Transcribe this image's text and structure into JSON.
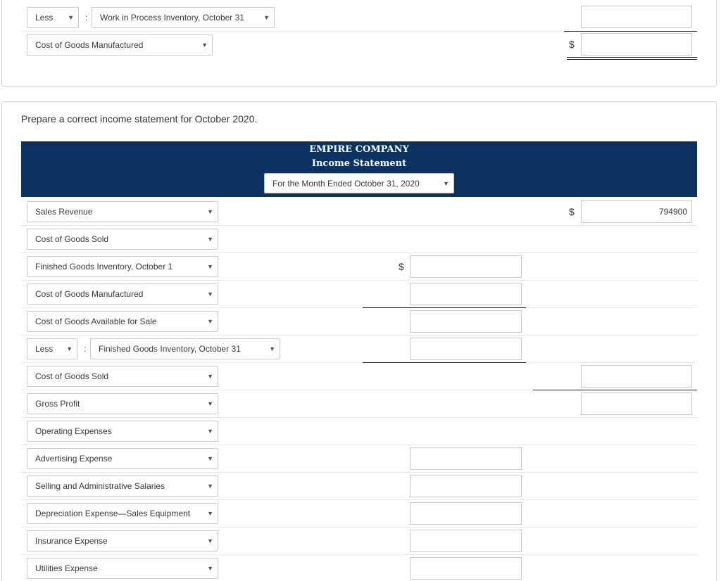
{
  "top_section": {
    "less_label": "Less",
    "colon": ":",
    "wip_label": "Work in Process Inventory, October 31",
    "cogm_label": "Cost of Goods Manufactured",
    "dollar": "$"
  },
  "prompt": "Prepare a correct income statement for October 2020.",
  "header": {
    "company": "EMPIRE COMPANY",
    "statement": "Income Statement",
    "period": "For the Month Ended October 31, 2020"
  },
  "rows": {
    "sales_revenue": {
      "label": "Sales Revenue",
      "value": "794900",
      "dollar": "$"
    },
    "cogs_heading": {
      "label": "Cost of Goods Sold"
    },
    "fg_inv_oct1": {
      "label": "Finished Goods Inventory, October 1",
      "dollar": "$"
    },
    "cogm": {
      "label": "Cost of Goods Manufactured"
    },
    "cogas": {
      "label": "Cost of Goods Available for Sale"
    },
    "less_fg_oct31": {
      "less_label": "Less",
      "colon": ":",
      "label": "Finished Goods Inventory, October 31"
    },
    "cogs_total": {
      "label": "Cost of Goods Sold"
    },
    "gross_profit": {
      "label": "Gross Profit"
    },
    "operating_expenses": {
      "label": "Operating Expenses"
    },
    "advertising": {
      "label": "Advertising Expense"
    },
    "salaries": {
      "label": "Selling and Administrative Salaries"
    },
    "depreciation": {
      "label": "Depreciation Expense—Sales Equipment"
    },
    "insurance": {
      "label": "Insurance Expense"
    },
    "utilities": {
      "label": "Utilities Expense"
    }
  },
  "icons": {
    "dropdown": "triangle-down"
  }
}
